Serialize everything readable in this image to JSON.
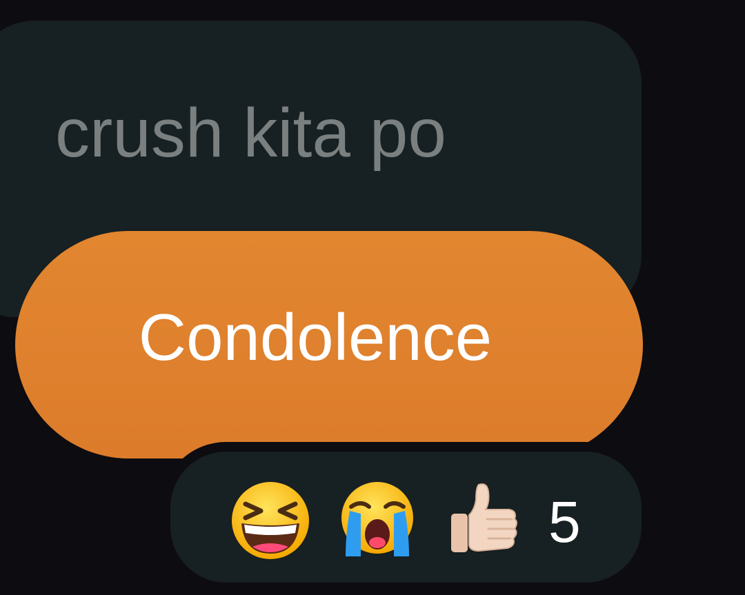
{
  "conversation": {
    "received_message": {
      "text": "crush kita po"
    },
    "reply_message": {
      "text": "Condolence"
    },
    "reactions": {
      "items": [
        {
          "icon": "grinning-squinting-face-icon"
        },
        {
          "icon": "loudly-crying-face-icon"
        },
        {
          "icon": "thumbs-up-icon"
        }
      ],
      "count": "5"
    }
  },
  "colors": {
    "background": "#0d0c10",
    "received_bubble": "#172022",
    "reply_bubble": "#df822e",
    "received_text": "#7a7f80",
    "reply_text": "#ffffff"
  }
}
